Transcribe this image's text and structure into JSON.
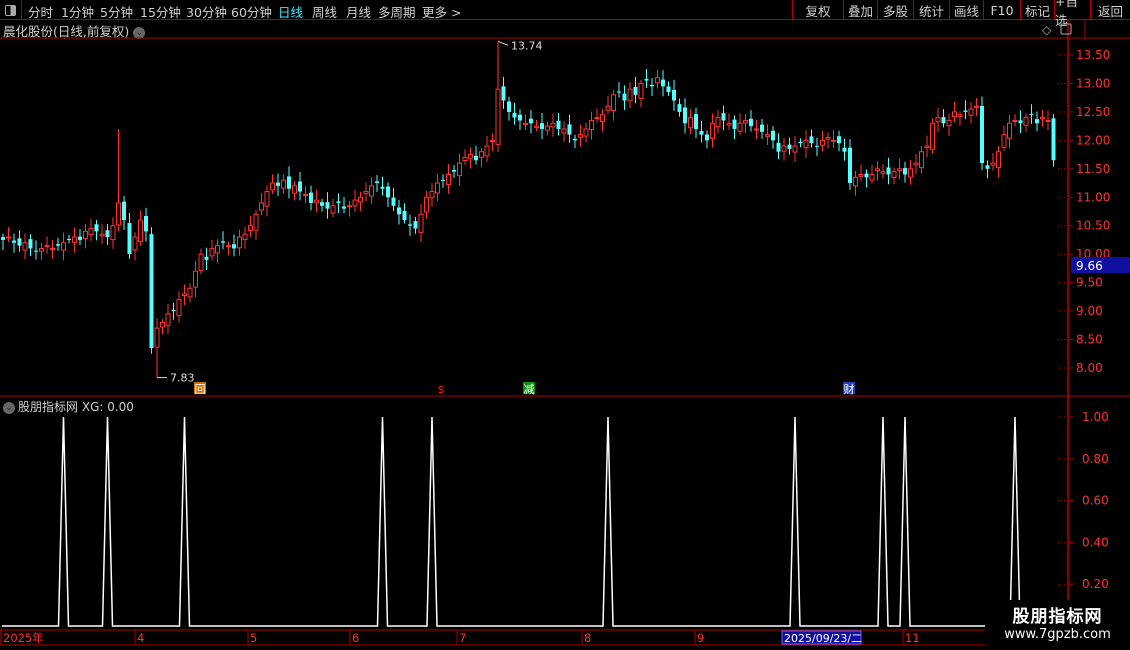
{
  "toolbar": {
    "periods": [
      "分时",
      "1分钟",
      "5分钟",
      "15分钟",
      "30分钟",
      "60分钟",
      "日线",
      "周线",
      "月线",
      "多周期",
      "更多 >"
    ],
    "active_period": "日线",
    "buttons": [
      "复权",
      "叠加",
      "多股",
      "统计",
      "画线",
      "F10",
      "标记",
      "+自选",
      "返回"
    ]
  },
  "main": {
    "title": "晨化股份(日线,前复权)",
    "y_ticks": [
      "13.50",
      "13.00",
      "12.50",
      "12.00",
      "11.50",
      "11.00",
      "10.50",
      "10.00",
      "9.50",
      "9.00",
      "8.50",
      "8.00"
    ],
    "current_price_label": "9.66",
    "high_label": "13.74",
    "low_label": "7.83",
    "markers": [
      {
        "glyph": "回",
        "color": "#c87000"
      },
      {
        "glyph": "$",
        "color": "#ff2020"
      },
      {
        "glyph": "减",
        "color": "#109010"
      },
      {
        "glyph": "财",
        "color": "#2040c0"
      }
    ]
  },
  "indicator": {
    "title": "股朋指标网",
    "value_label": "XG: 0.00",
    "y_ticks": [
      "1.00",
      "0.80",
      "0.60",
      "0.40",
      "0.20"
    ]
  },
  "time_axis": {
    "labels": [
      "2025年",
      "4",
      "5",
      "6",
      "7",
      "8",
      "9",
      "11"
    ],
    "cursor_date": "2025/09/23/二"
  },
  "watermark": {
    "line1": "股朋指标网",
    "line2": "www.7gpzb.com"
  },
  "colors": {
    "up": "#ff3232",
    "down": "#54ffff",
    "axis": "#b00000",
    "active": "#3ee8ff"
  },
  "chart_data": {
    "type": "candlestick",
    "ylim": [
      7.6,
      13.9
    ],
    "high": 13.74,
    "low": 7.83,
    "close": [
      10.25,
      10.3,
      10.2,
      10.15,
      10.2,
      10.1,
      10.05,
      10.1,
      10.15,
      10.1,
      10.15,
      10.2,
      10.25,
      10.3,
      10.25,
      10.4,
      10.45,
      10.4,
      10.35,
      10.3,
      10.5,
      10.9,
      10.6,
      10.0,
      10.3,
      10.6,
      10.4,
      8.35,
      8.7,
      8.8,
      8.95,
      9.0,
      9.2,
      9.3,
      9.4,
      9.7,
      10.0,
      9.9,
      10.1,
      10.15,
      10.2,
      10.15,
      10.1,
      10.3,
      10.35,
      10.5,
      10.7,
      10.9,
      11.1,
      11.25,
      11.2,
      11.3,
      11.15,
      11.2,
      11.1,
      11.05,
      10.9,
      10.95,
      10.85,
      10.8,
      10.85,
      10.9,
      10.8,
      10.85,
      10.95,
      11.0,
      11.1,
      11.2,
      11.25,
      11.15,
      11.0,
      10.85,
      10.7,
      10.6,
      10.5,
      10.45,
      10.7,
      11.0,
      11.1,
      11.25,
      11.3,
      11.4,
      11.45,
      11.6,
      11.7,
      11.75,
      11.65,
      11.8,
      11.9,
      12.0,
      12.9,
      12.7,
      12.5,
      12.4,
      12.35,
      12.3,
      12.3,
      12.25,
      12.2,
      12.25,
      12.3,
      12.2,
      12.2,
      12.1,
      12.0,
      12.1,
      12.2,
      12.35,
      12.4,
      12.45,
      12.6,
      12.8,
      12.85,
      12.7,
      12.9,
      12.8,
      13.0,
      13.05,
      12.95,
      13.1,
      12.95,
      12.85,
      12.7,
      12.5,
      12.3,
      12.4,
      12.2,
      12.1,
      12.0,
      12.3,
      12.4,
      12.35,
      12.3,
      12.2,
      12.3,
      12.35,
      12.25,
      12.2,
      12.15,
      12.1,
      12.0,
      11.8,
      11.9,
      11.85,
      11.9,
      11.95,
      12.0,
      11.95,
      11.9,
      12.0,
      12.05,
      12.0,
      11.95,
      11.8,
      11.25,
      11.35,
      11.4,
      11.35,
      11.4,
      11.5,
      11.45,
      11.4,
      11.45,
      11.5,
      11.4,
      11.5,
      11.6,
      11.8,
      11.9,
      12.3,
      12.4,
      12.3,
      12.35,
      12.5,
      12.45,
      12.5,
      12.55,
      12.6,
      11.6,
      11.5,
      11.6,
      11.8,
      12.1,
      12.3,
      12.35,
      12.3,
      12.4,
      12.45,
      12.3,
      12.4,
      12.35,
      11.65
    ],
    "xg_signal_indices": [
      11,
      19,
      33,
      69,
      78,
      110,
      144,
      160,
      164,
      184
    ],
    "xg_ylim": [
      0,
      1.1
    ]
  }
}
